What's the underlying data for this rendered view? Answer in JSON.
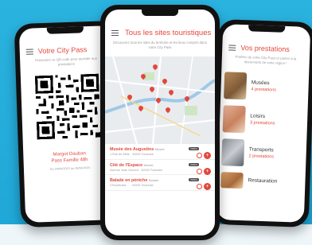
{
  "left_phone": {
    "title": "Votre City Pass",
    "subtitle": "Présentez ce QR code pour accéder aux prestations",
    "holder_name": "Margot Dauban",
    "pass_type": "Pass Famille 48h",
    "validity": "Du 24/04/2023 au 26/04/2023"
  },
  "center_phone": {
    "title": "Tous les sites touristiques",
    "subtitle": "Découvrez tous les sites du territoire et les lieux compris dans votre City Pass",
    "pois": [
      {
        "name": "Musée des Augustins",
        "category": "Musée",
        "address": "1 Rue de Metz · 31000 Toulouse",
        "badge": "Inclus"
      },
      {
        "name": "Cité de l'Espace",
        "category": "Musée",
        "address": "Avenue Jean Gonord · 31000 Toulouse",
        "badge": "Inclus"
      },
      {
        "name": "Balade en péniche",
        "category": "Balade",
        "address": "3 Boulevard ... · 31000 Toulouse",
        "badge": "Inclus"
      }
    ]
  },
  "right_phone": {
    "title": "Vos prestations",
    "subtitle": "Profitez de votre City Pass et partez à la découverte de votre région !",
    "services": [
      {
        "name": "Musées",
        "count": "4 prestations"
      },
      {
        "name": "Loisirs",
        "count": "3 prestations"
      },
      {
        "name": "Transports",
        "count": "2 prestations"
      },
      {
        "name": "Restauration",
        "count": ""
      }
    ]
  },
  "colors": {
    "accent": "#e2473b",
    "background": "#1fa6d6"
  }
}
